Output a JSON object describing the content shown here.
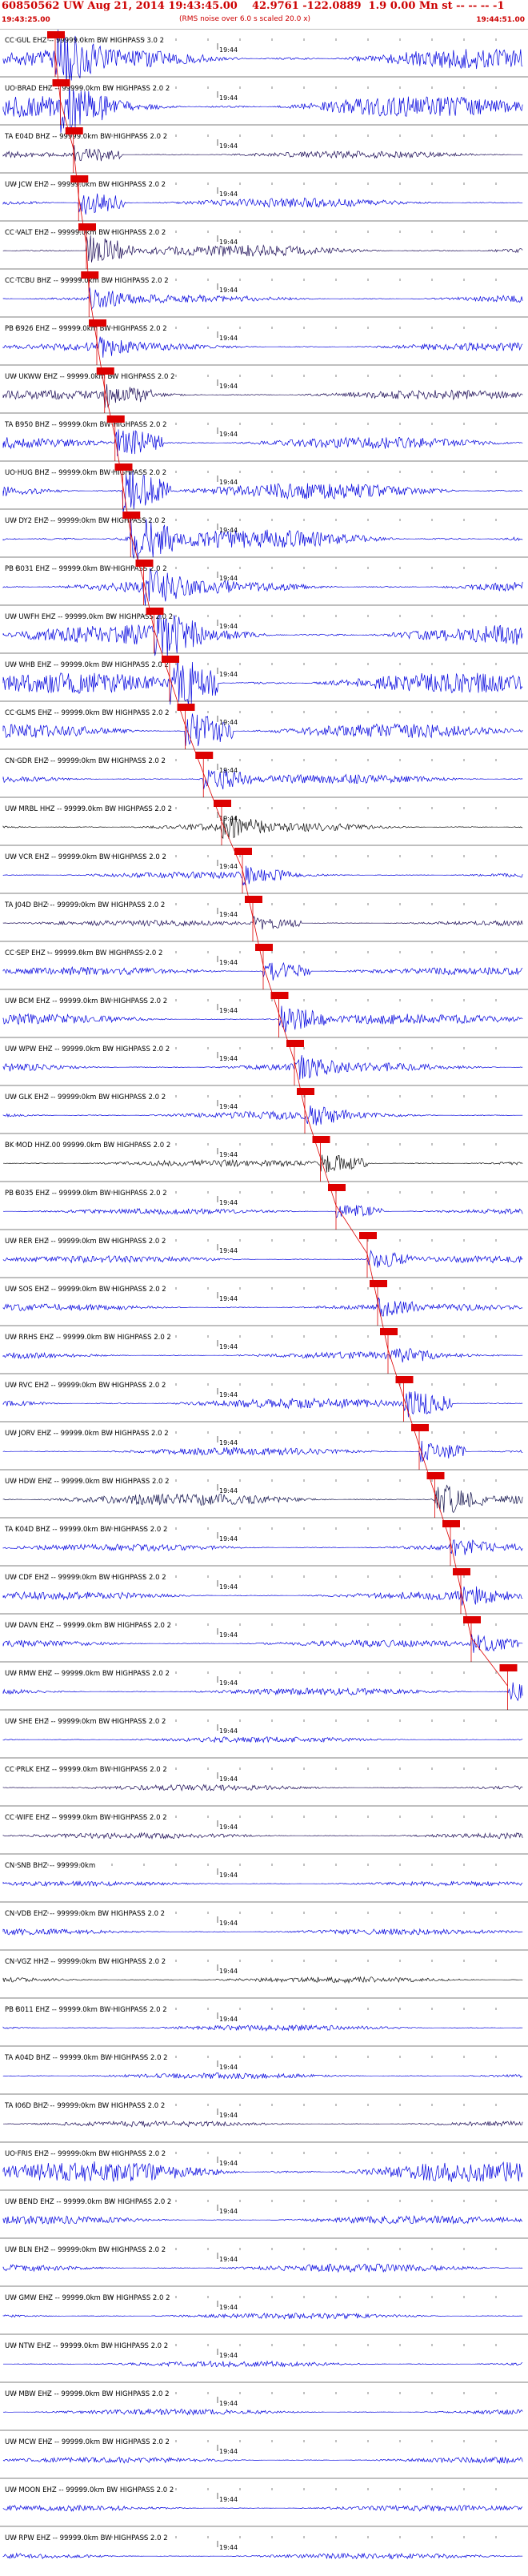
{
  "header": {
    "title": "60850562 UW Aug 21, 2014 19:43:45.00    42.9761 -122.0889  1.9 0.00 Mn st -- -- -- -1",
    "subtitle": "(RMS noise over 6.0 s scaled 20.0 x)",
    "start_time": "19:43:25.00",
    "end_time": "19:44:51.00"
  },
  "colors": {
    "pick": "#dd0000",
    "axis": "#000000",
    "trace_blue": "#0000dd",
    "trace_dark": "#1a0a55",
    "trace_black": "#111111",
    "trace_navy": "#10104a"
  },
  "chart_data": {
    "type": "line",
    "title": "60850562 UW Aug 21, 2014 19:43:45.00    42.9761 -122.0889  1.9 0.00 Mn st -- -- -- -1",
    "xlabel": "",
    "ylabel": "",
    "tick_label": "19:44",
    "x_range": [
      "19:43:25.00",
      "19:44:51.00"
    ],
    "traces": [
      {
        "label": "CC GUL EHZ -- 99999.0km BW  HIGHPASS  3.0  2",
        "color": "blue",
        "amp": 0.9,
        "has_pick": true,
        "pick_time": 0.1
      },
      {
        "label": "UO BRAD EHZ -- 99999.0km BW  HIGHPASS  2.0  2",
        "color": "blue",
        "amp": 0.9,
        "has_pick": true,
        "pick_time": 0.11
      },
      {
        "label": "TA E04D BHZ -- 99999.0km BW  HIGHPASS  2.0  2",
        "color": "dark",
        "amp": 0.3,
        "has_pick": true,
        "pick_time": 0.135
      },
      {
        "label": "UW JCW EHZ -- 99999.0km BW  HIGHPASS  2.0  2",
        "color": "blue",
        "amp": 0.4,
        "has_pick": true,
        "pick_time": 0.145
      },
      {
        "label": "CC VALT EHZ -- 99999.0km BW  HIGHPASS  2.0  2",
        "color": "dark",
        "amp": 0.5,
        "has_pick": true,
        "pick_time": 0.16
      },
      {
        "label": "CC TCBU BHZ -- 99999.0km BW  HIGHPASS  2.0  2",
        "color": "blue",
        "amp": 0.35,
        "has_pick": true,
        "pick_time": 0.165
      },
      {
        "label": "PB B926 EHZ -- 99999.0km BW  HIGHPASS  2.0  2",
        "color": "blue",
        "amp": 0.35,
        "has_pick": true,
        "pick_time": 0.18
      },
      {
        "label": "UW UKWW EHZ -- 99999.0km BW  HIGHPASS  2.0  2",
        "color": "dark",
        "amp": 0.4,
        "has_pick": true,
        "pick_time": 0.195
      },
      {
        "label": "TA B950 BHZ -- 99999.0km BW  HIGHPASS  2.0  2",
        "color": "blue",
        "amp": 0.5,
        "has_pick": true,
        "pick_time": 0.215
      },
      {
        "label": "UO HUG BHZ -- 99999.0km BW  HIGHPASS  2.0  2",
        "color": "blue",
        "amp": 0.7,
        "has_pick": true,
        "pick_time": 0.23
      },
      {
        "label": "UW DY2 EHZ -- 99999.0km BW  HIGHPASS  2.0  2",
        "color": "blue",
        "amp": 0.8,
        "has_pick": true,
        "pick_time": 0.245
      },
      {
        "label": "PB B031 EHZ -- 99999.0km BW  HIGHPASS  2.0  2",
        "color": "blue",
        "amp": 0.6,
        "has_pick": true,
        "pick_time": 0.27
      },
      {
        "label": "UW UWFH EHZ -- 99999.0km BW  HIGHPASS  2.0  2",
        "color": "blue",
        "amp": 0.85,
        "has_pick": true,
        "pick_time": 0.29
      },
      {
        "label": "UW WHB EHZ -- 99999.0km BW  HIGHPASS  2.0  2",
        "color": "blue",
        "amp": 0.9,
        "has_pick": true,
        "pick_time": 0.32
      },
      {
        "label": "CC GLMS EHZ -- 99999.0km BW  HIGHPASS  2.0  2",
        "color": "blue",
        "amp": 0.6,
        "has_pick": true,
        "pick_time": 0.35
      },
      {
        "label": "CN GDR EHZ -- 99999.0km BW  HIGHPASS  2.0  2",
        "color": "blue",
        "amp": 0.4,
        "has_pick": true,
        "pick_time": 0.385
      },
      {
        "label": "UW MRBL HHZ -- 99999.0km BW  HIGHPASS  2.0  2",
        "color": "black",
        "amp": 0.4,
        "has_pick": true,
        "pick_time": 0.42
      },
      {
        "label": "UW VCR EHZ -- 99999.0km BW  HIGHPASS  2.0  2",
        "color": "blue",
        "amp": 0.3,
        "has_pick": true,
        "pick_time": 0.46
      },
      {
        "label": "TA J04D BHZ -- 99999.0km BW  HIGHPASS  2.0  2",
        "color": "dark",
        "amp": 0.25,
        "has_pick": true,
        "pick_time": 0.48
      },
      {
        "label": "CC SEP EHZ -- 99999.0km BW  HIGHPASS  2.0  2",
        "color": "blue",
        "amp": 0.35,
        "has_pick": true,
        "pick_time": 0.5
      },
      {
        "label": "UW BCM EHZ -- 99999.0km BW  HIGHPASS  2.0  2",
        "color": "blue",
        "amp": 0.45,
        "has_pick": true,
        "pick_time": 0.53
      },
      {
        "label": "UW WPW EHZ -- 99999.0km BW  HIGHPASS  2.0  2",
        "color": "blue",
        "amp": 0.4,
        "has_pick": true,
        "pick_time": 0.56
      },
      {
        "label": "UW GLK EHZ -- 99999.0km BW  HIGHPASS  2.0  2",
        "color": "blue",
        "amp": 0.35,
        "has_pick": true,
        "pick_time": 0.58
      },
      {
        "label": "BK MOD HHZ.00 99999.0km BW  HIGHPASS  2.0  2",
        "color": "black",
        "amp": 0.3,
        "has_pick": true,
        "pick_time": 0.61
      },
      {
        "label": "PB B035 EHZ -- 99999.0km BW  HIGHPASS  2.0  2",
        "color": "blue",
        "amp": 0.25,
        "has_pick": true,
        "pick_time": 0.64
      },
      {
        "label": "UW RER EHZ -- 99999.0km BW  HIGHPASS  2.0  2",
        "color": "blue",
        "amp": 0.3,
        "has_pick": true,
        "pick_time": 0.7
      },
      {
        "label": "UW SOS EHZ -- 99999.0km BW  HIGHPASS  2.0  2",
        "color": "blue",
        "amp": 0.3,
        "has_pick": true,
        "pick_time": 0.72
      },
      {
        "label": "UW RRHS EHZ -- 99999.0km BW  HIGHPASS  2.0  2",
        "color": "blue",
        "amp": 0.3,
        "has_pick": true,
        "pick_time": 0.74
      },
      {
        "label": "UW RVC EHZ -- 99999.0km BW  HIGHPASS  2.0  2",
        "color": "blue",
        "amp": 0.45,
        "has_pick": true,
        "pick_time": 0.77
      },
      {
        "label": "UW JORV EHZ -- 99999.0km BW  HIGHPASS  2.0  2",
        "color": "blue",
        "amp": 0.35,
        "has_pick": true,
        "pick_time": 0.8
      },
      {
        "label": "UW HDW EHZ -- 99999.0km BW  HIGHPASS  2.0  2",
        "color": "navy",
        "amp": 0.5,
        "has_pick": true,
        "pick_time": 0.83
      },
      {
        "label": "TA K04D BHZ -- 99999.0km BW  HIGHPASS  2.0  2",
        "color": "blue",
        "amp": 0.3,
        "has_pick": true,
        "pick_time": 0.86
      },
      {
        "label": "UW CDF EHZ -- 99999.0km BW  HIGHPASS  2.0  2",
        "color": "blue",
        "amp": 0.35,
        "has_pick": true,
        "pick_time": 0.88
      },
      {
        "label": "UW DAVN EHZ -- 99999.0km BW  HIGHPASS  2.0  2",
        "color": "blue",
        "amp": 0.3,
        "has_pick": true,
        "pick_time": 0.9
      },
      {
        "label": "UW RMW EHZ -- 99999.0km BW  HIGHPASS  2.0  2",
        "color": "blue",
        "amp": 0.3,
        "has_pick": true,
        "pick_time": 0.97
      },
      {
        "label": "UW SHE EHZ -- 99999.0km BW  HIGHPASS  2.0  2",
        "color": "blue",
        "amp": 0.25,
        "has_pick": false
      },
      {
        "label": "CC PRLK EHZ -- 99999.0km BW  HIGHPASS  2.0  2",
        "color": "dark",
        "amp": 0.25,
        "has_pick": false
      },
      {
        "label": "CC WIFE EHZ -- 99999.0km BW  HIGHPASS  2.0  2",
        "color": "dark",
        "amp": 0.25,
        "has_pick": false
      },
      {
        "label": "CN SNB BHZ -- 99999.0km",
        "color": "blue",
        "amp": 0.2,
        "has_pick": false
      },
      {
        "label": "CN VDB EHZ -- 99999.0km BW  HIGHPASS  2.0  2",
        "color": "blue",
        "amp": 0.25,
        "has_pick": false
      },
      {
        "label": "CN VGZ HHZ -- 99999.0km BW  HIGHPASS  2.0  2",
        "color": "black",
        "amp": 0.25,
        "has_pick": false
      },
      {
        "label": "PB B011 EHZ -- 99999.0km BW  HIGHPASS  2.0  2",
        "color": "blue",
        "amp": 0.25,
        "has_pick": false
      },
      {
        "label": "TA A04D BHZ -- 99999.0km BW  HIGHPASS  2.0  2",
        "color": "blue",
        "amp": 0.25,
        "has_pick": false
      },
      {
        "label": "TA I06D BHZ -- 99999.0km BW  HIGHPASS  2.0  2",
        "color": "dark",
        "amp": 0.25,
        "has_pick": false
      },
      {
        "label": "UO FRIS EHZ -- 99999.0km BW  HIGHPASS  2.0  2",
        "color": "blue",
        "amp": 0.9,
        "has_pick": false
      },
      {
        "label": "UW BEND EHZ -- 99999.0km BW  HIGHPASS  2.0  2",
        "color": "blue",
        "amp": 0.35,
        "has_pick": false
      },
      {
        "label": "UW BLN EHZ -- 99999.0km BW  HIGHPASS  2.0  2",
        "color": "blue",
        "amp": 0.35,
        "has_pick": false
      },
      {
        "label": "UW GMW EHZ -- 99999.0km BW  HIGHPASS  2.0  2",
        "color": "blue",
        "amp": 0.25,
        "has_pick": false
      },
      {
        "label": "UW NTW EHZ -- 99999.0km BW  HIGHPASS  2.0  2",
        "color": "blue",
        "amp": 0.25,
        "has_pick": false
      },
      {
        "label": "UW MBW EHZ -- 99999.0km BW  HIGHPASS  2.0  2",
        "color": "blue",
        "amp": 0.25,
        "has_pick": false
      },
      {
        "label": "UW MCW EHZ -- 99999.0km BW  HIGHPASS  2.0  2",
        "color": "blue",
        "amp": 0.25,
        "has_pick": false
      },
      {
        "label": "UW MOON EHZ -- 99999.0km BW  HIGHPASS  2.0  2",
        "color": "blue",
        "amp": 0.25,
        "has_pick": false
      },
      {
        "label": "UW RPW EHZ -- 99999.0km BW  HIGHPASS  2.0  2",
        "color": "blue",
        "amp": 0.25,
        "has_pick": false
      }
    ]
  }
}
